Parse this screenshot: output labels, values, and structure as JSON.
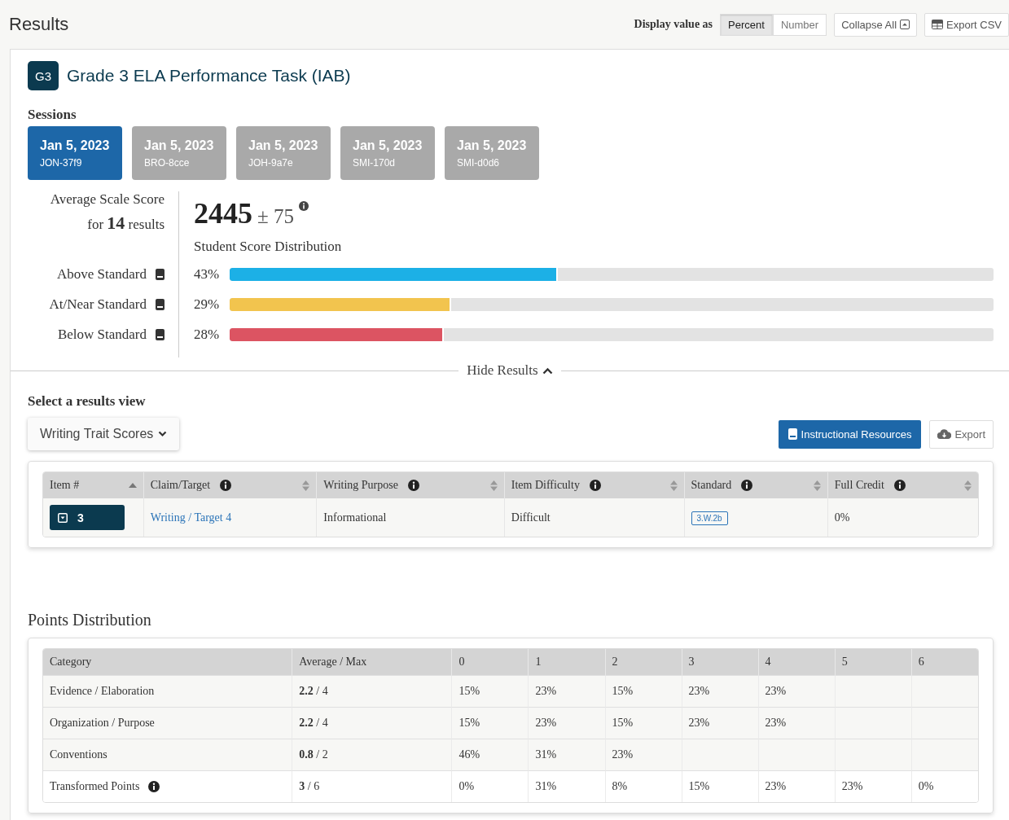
{
  "header": {
    "title": "Results",
    "display_label": "Display value as",
    "display_options": [
      {
        "label": "Percent",
        "selected": true
      },
      {
        "label": "Number",
        "selected": false
      }
    ],
    "collapse_button": "Collapse All",
    "export_button": "Export CSV"
  },
  "assessment": {
    "badge": "G3",
    "title": "Grade 3 ELA Performance Task (IAB)"
  },
  "sessions_label": "Sessions",
  "sessions": [
    {
      "date": "Jan 5, 2023",
      "code": "JON-37f9",
      "selected": true
    },
    {
      "date": "Jan 5, 2023",
      "code": "BRO-8cce",
      "selected": false
    },
    {
      "date": "Jan 5, 2023",
      "code": "JOH-9a7e",
      "selected": false
    },
    {
      "date": "Jan 5, 2023",
      "code": "SMI-170d",
      "selected": false
    },
    {
      "date": "Jan 5, 2023",
      "code": "SMI-d0d6",
      "selected": false
    }
  ],
  "score": {
    "label": "Average Scale Score",
    "count_text": "for **14** results",
    "value": "2445",
    "error": "± 75"
  },
  "distribution_title": "Student Score Distribution",
  "levels": [
    {
      "label": "Above Standard",
      "percent": "43%",
      "level": 0.43,
      "color": "#1cb0e6"
    },
    {
      "label": "At/Near Standard",
      "percent": "29%",
      "level": 0.29,
      "color": "#f2c44e"
    },
    {
      "label": "Below Standard",
      "percent": "28%",
      "level": 0.28,
      "color": "#dc5462"
    }
  ],
  "hide_results": "Hide Results",
  "results_view": {
    "label": "Select a results view",
    "dropdown": "Writing Trait Scores",
    "resources_button": "Instructional Resources",
    "export_button": "Export"
  },
  "items_table": {
    "columns": [
      {
        "label": "Item #",
        "info": false,
        "sorted": true
      },
      {
        "label": "Claim/Target",
        "info": true,
        "sorted": false
      },
      {
        "label": "Writing Purpose",
        "info": true,
        "sorted": false
      },
      {
        "label": "Item Difficulty",
        "info": true,
        "sorted": false
      },
      {
        "label": "Standard",
        "info": true,
        "sorted": false
      },
      {
        "label": "Full Credit",
        "info": true,
        "sorted": false
      }
    ],
    "rows": [
      {
        "item": "3",
        "claim_target": "Writing / Target 4",
        "purpose": "Informational",
        "difficulty": "Difficult",
        "standard": "3.W.2b",
        "full_credit": "0%"
      }
    ]
  },
  "points_title": "Points Distribution",
  "points_table": {
    "columns": [
      "Category",
      "Average / Max",
      "0",
      "1",
      "2",
      "3",
      "4",
      "5",
      "6"
    ],
    "rows": [
      {
        "kind": "trait",
        "info": false,
        "cells": [
          "Evidence / Elaboration",
          "**2.2** / 4",
          "15%",
          "23%",
          "15%",
          "23%",
          "23%",
          "",
          ""
        ]
      },
      {
        "kind": "trait",
        "info": false,
        "cells": [
          "Organization / Purpose",
          "**2.2** / 4",
          "15%",
          "23%",
          "15%",
          "23%",
          "23%",
          "",
          ""
        ]
      },
      {
        "kind": "trait",
        "info": false,
        "cells": [
          "Conventions",
          "**0.8** / 2",
          "46%",
          "31%",
          "23%",
          "",
          "",
          "",
          ""
        ]
      },
      {
        "kind": "total",
        "info": true,
        "cells": [
          "Transformed Points",
          "**3** / 6",
          "0%",
          "31%",
          "8%",
          "15%",
          "23%",
          "23%",
          "0%"
        ]
      }
    ]
  }
}
